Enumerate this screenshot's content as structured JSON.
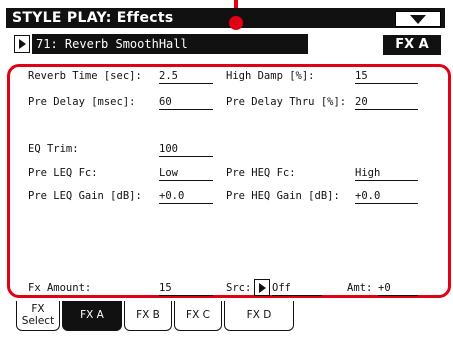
{
  "titlebar": {
    "title": "STYLE PLAY: Effects"
  },
  "effect": {
    "name": "71: Reverb SmoothHall",
    "fx_slot": "FX A"
  },
  "params": {
    "reverb_time_label": "Reverb Time [sec]:",
    "reverb_time_value": "2.5",
    "high_damp_label": "High Damp [%]:",
    "high_damp_value": "15",
    "pre_delay_label": "Pre Delay [msec]:",
    "pre_delay_value": "60",
    "pre_delay_thru_label": "Pre Delay Thru [%]:",
    "pre_delay_thru_value": "20",
    "eq_trim_label": "EQ Trim:",
    "eq_trim_value": "100",
    "pre_leq_fc_label": "Pre LEQ Fc:",
    "pre_leq_fc_value": "Low",
    "pre_heq_fc_label": "Pre HEQ Fc:",
    "pre_heq_fc_value": "High",
    "pre_leq_gain_label": "Pre LEQ Gain [dB]:",
    "pre_leq_gain_value": "+0.0",
    "pre_heq_gain_label": "Pre HEQ Gain [dB]:",
    "pre_heq_gain_value": "+0.0",
    "fx_amount_label": "Fx Amount:",
    "fx_amount_value": "15",
    "src_label": "Src:",
    "src_value": "Off",
    "amt_label": "Amt:",
    "amt_value": "+0"
  },
  "tabs": [
    {
      "line1": "FX",
      "line2": "Select"
    },
    {
      "line1": "FX A",
      "line2": ""
    },
    {
      "line1": "FX B",
      "line2": ""
    },
    {
      "line1": "FX C",
      "line2": ""
    },
    {
      "line1": "FX D",
      "line2": ""
    }
  ],
  "colors": {
    "highlight": "#e10014",
    "dark": "#111111"
  },
  "icons": {
    "menu": "triangle-down-icon",
    "play": "triangle-right-icon"
  }
}
